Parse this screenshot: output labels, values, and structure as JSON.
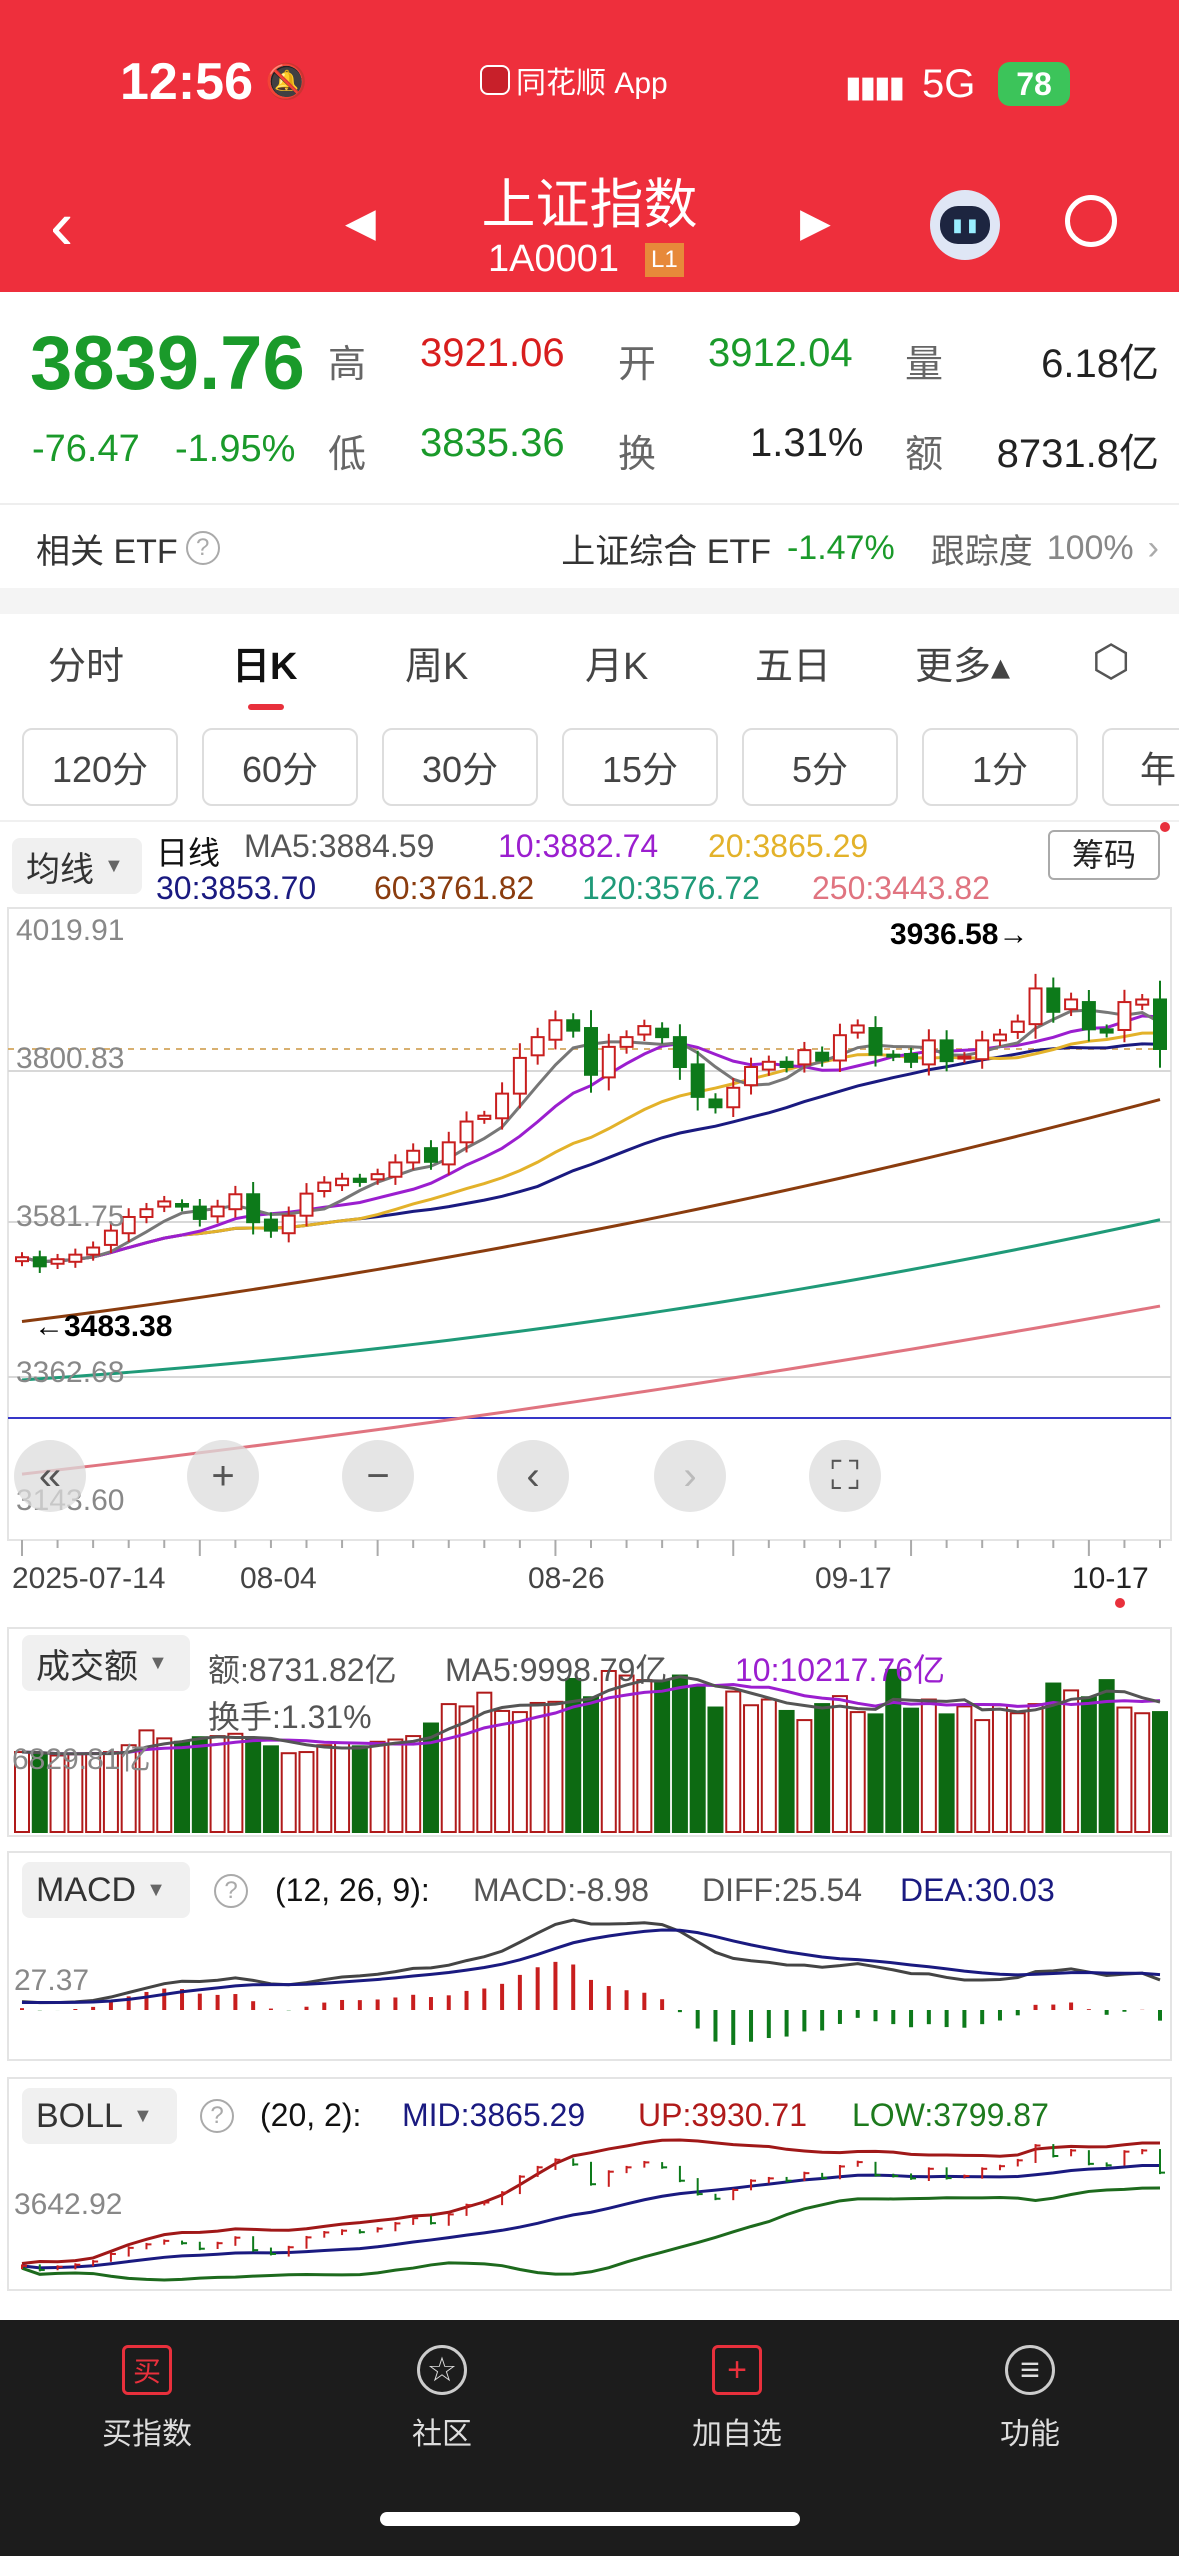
{
  "status": {
    "time": "12:56",
    "app": "同花顺 App",
    "network": "5G",
    "battery": "78"
  },
  "header": {
    "title": "上证指数",
    "code": "1A0001",
    "level": "L1"
  },
  "quote": {
    "price": "3839.76",
    "change": "-76.47",
    "change_pct": "-1.95%",
    "high_label": "高",
    "high": "3921.06",
    "open_label": "开",
    "open": "3912.04",
    "vol_label": "量",
    "vol": "6.18亿",
    "low_label": "低",
    "low": "3835.36",
    "turn_label": "换",
    "turn": "1.31%",
    "amt_label": "额",
    "amt": "8731.8亿"
  },
  "etf": {
    "label": "相关 ETF",
    "name": "上证综合 ETF",
    "pct": "-1.47%",
    "track_label": "跟踪度",
    "track": "100%"
  },
  "tabs": [
    "分时",
    "日K",
    "周K",
    "月K",
    "五日",
    "更多▴"
  ],
  "periods": [
    "120分",
    "60分",
    "30分",
    "15分",
    "5分",
    "1分",
    "年"
  ],
  "legend": {
    "selector": "均线",
    "kind": "日线",
    "ma5": "MA5:3884.59",
    "ma10": "10:3882.74",
    "ma20": "20:3865.29",
    "ma30": "30:3853.70",
    "ma60": "60:3761.82",
    "ma120": "120:3576.72",
    "ma250": "250:3443.82",
    "chip": "筹码"
  },
  "yaxis": [
    "4019.91",
    "3800.83",
    "3581.75",
    "3362.68",
    "3143.60"
  ],
  "annotations": {
    "high": "3936.58→",
    "low": "←3483.38"
  },
  "dates": [
    "2025-07-14",
    "08-04",
    "08-26",
    "09-17",
    "10-17"
  ],
  "controls": [
    "«",
    "+",
    "−",
    "‹",
    "›",
    "⛶"
  ],
  "volume": {
    "selector": "成交额",
    "amt": "额:8731.82亿",
    "ma5": "MA5:9998.79亿",
    "ma10": "10:10217.76亿",
    "turn": "换手:1.31%",
    "ylabel": "6829.81亿"
  },
  "macd": {
    "selector": "MACD",
    "params": "(12, 26, 9):",
    "macd": "MACD:-8.98",
    "diff": "DIFF:25.54",
    "dea": "DEA:30.03",
    "ylabel": "27.37"
  },
  "boll": {
    "selector": "BOLL",
    "params": "(20, 2):",
    "mid": "MID:3865.29",
    "up": "UP:3930.71",
    "low": "LOW:3799.87",
    "ylabel": "3642.92"
  },
  "nav": [
    {
      "label": "买指数",
      "icon": "买"
    },
    {
      "label": "社区",
      "icon": "☆"
    },
    {
      "label": "加自选",
      "icon": "+"
    },
    {
      "label": "功能",
      "icon": "≡"
    }
  ],
  "chart_data": {
    "type": "candlestick",
    "price_range": [
      3143.6,
      4019.91
    ],
    "closes": [
      3519,
      3505,
      3516,
      3523,
      3534,
      3560,
      3581,
      3593,
      3605,
      3597,
      3578,
      3597,
      3616,
      3573,
      3560,
      3583,
      3617,
      3634,
      3640,
      3635,
      3647,
      3665,
      3683,
      3666,
      3696,
      3728,
      3737,
      3771,
      3826,
      3858,
      3884,
      3868,
      3800,
      3843,
      3858,
      3875,
      3858,
      3812,
      3766,
      3750,
      3780,
      3812,
      3820,
      3812,
      3838,
      3822,
      3861,
      3876,
      3831,
      3828,
      3820,
      3853,
      3821,
      3828,
      3853,
      3862,
      3882,
      3933,
      3897,
      3916,
      3870,
      3865,
      3912,
      3916,
      3839.76
    ],
    "ma_long": {
      "60": [
        3420,
        3560,
        3761.82
      ],
      "120": [
        3330,
        3420,
        3576.72
      ],
      "250": [
        3185,
        3300,
        3443.82
      ]
    },
    "volumes": [
      7000,
      6900,
      6700,
      6800,
      6900,
      7000,
      7600,
      8900,
      8200,
      7900,
      8300,
      8400,
      8600,
      8200,
      7500,
      6900,
      7000,
      7600,
      7800,
      7500,
      7900,
      8100,
      8400,
      9500,
      11200,
      11000,
      12200,
      10600,
      10500,
      11300,
      11400,
      13400,
      11800,
      14100,
      13700,
      13300,
      13200,
      13700,
      12800,
      10900,
      12300,
      11100,
      11600,
      10600,
      9800,
      11200,
      11900,
      10500,
      10300,
      14200,
      10800,
      11600,
      10300,
      11000,
      9800,
      11100,
      10400,
      11200,
      13000,
      12400,
      11800,
      13300,
      10900,
      10400,
      10500
    ]
  }
}
